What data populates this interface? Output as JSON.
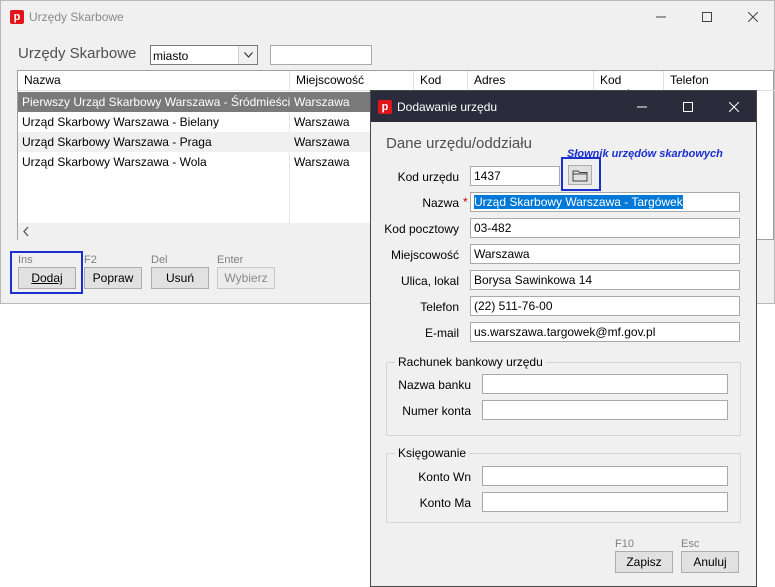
{
  "main_window": {
    "title": "Urzędy Skarbowe",
    "heading": "Urzędy Skarbowe",
    "filter_select": "miasto",
    "filter_value": "",
    "columns": [
      "Nazwa",
      "Miejscowość",
      "Kod",
      "Adres",
      "Kod urzędu",
      "Telefon"
    ],
    "rows": [
      {
        "name": "Pierwszy Urząd Skarbowy Warszawa - Śródmieście",
        "city": "Warszawa"
      },
      {
        "name": "Urząd Skarbowy Warszawa - Bielany",
        "city": "Warszawa"
      },
      {
        "name": "Urząd Skarbowy Warszawa - Praga",
        "city": "Warszawa"
      },
      {
        "name": "Urząd Skarbowy Warszawa - Wola",
        "city": "Warszawa"
      }
    ],
    "buttons": [
      {
        "key": "Ins",
        "label": "Dodaj"
      },
      {
        "key": "F2",
        "label": "Popraw"
      },
      {
        "key": "Del",
        "label": "Usuń"
      },
      {
        "key": "Enter",
        "label": "Wybierz"
      }
    ]
  },
  "dialog": {
    "title": "Dodawanie urzędu",
    "heading": "Dane urzędu/oddziału",
    "dictionary_link": "Słownik urzędów skarbowych",
    "fields": {
      "kod_label": "Kod urzędu",
      "kod_value": "1437",
      "nazwa_label": "Nazwa",
      "nazwa_value": "Urząd Skarbowy Warszawa - Targówek",
      "required_mark": "*",
      "kod_pocztowy_label": "Kod pocztowy",
      "kod_pocztowy_value": "03-482",
      "miejscowosc_label": "Miejscowość",
      "miejscowosc_value": "Warszawa",
      "ulica_label": "Ulica, lokal",
      "ulica_value": "Borysa Sawinkowa 14",
      "telefon_label": "Telefon",
      "telefon_value": "(22) 511-76-00",
      "email_label": "E-mail",
      "email_value": "us.warszawa.targowek@mf.gov.pl"
    },
    "bank_group": {
      "title": "Rachunek bankowy urzędu",
      "bank_label": "Nazwa banku",
      "bank_value": "",
      "account_label": "Numer konta",
      "account_value": ""
    },
    "ledger_group": {
      "title": "Księgowanie",
      "wn_label": "Konto Wn",
      "wn_value": "",
      "ma_label": "Konto Ma",
      "ma_value": ""
    },
    "save": {
      "key": "F10",
      "label": "Zapisz"
    },
    "cancel": {
      "key": "Esc",
      "label": "Anuluj"
    }
  },
  "colors": {
    "accent_outline": "#1a2fcf",
    "selection": "#0078d7",
    "app_icon": "#e0161b",
    "selected_row": "#7a7a7a"
  }
}
